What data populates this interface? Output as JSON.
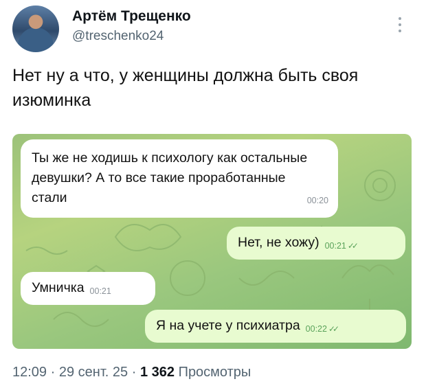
{
  "author": {
    "name": "Артём Трещенко",
    "handle": "@treschenko24"
  },
  "tweet": {
    "text": "Нет ну а что, у женщины должна быть своя изюминка"
  },
  "messages": [
    {
      "side": "in",
      "text": "Ты же не ходишь к психологу как остальные девушки? А то все такие проработанные стали",
      "time": "00:20"
    },
    {
      "side": "out",
      "text": "Нет, не хожу)",
      "time": "00:21",
      "read": "✓✓"
    },
    {
      "side": "in",
      "text": "Умничка",
      "time": "00:21"
    },
    {
      "side": "out",
      "text": "Я на учете у психиатра",
      "time": "00:22",
      "read": "✓✓"
    }
  ],
  "meta": {
    "time": "12:09",
    "sep": "·",
    "date": "29 сент. 25",
    "views_count": "1 362",
    "views_label": "Просмотры"
  },
  "colors": {
    "chat_bg": "#a3c97c",
    "outgoing_bubble": "#e8fbd0",
    "incoming_bubble": "#ffffff",
    "muted": "#536471"
  },
  "icons": {
    "avatar": "user-avatar",
    "more": "more-vertical-icon",
    "read": "double-check-icon"
  }
}
